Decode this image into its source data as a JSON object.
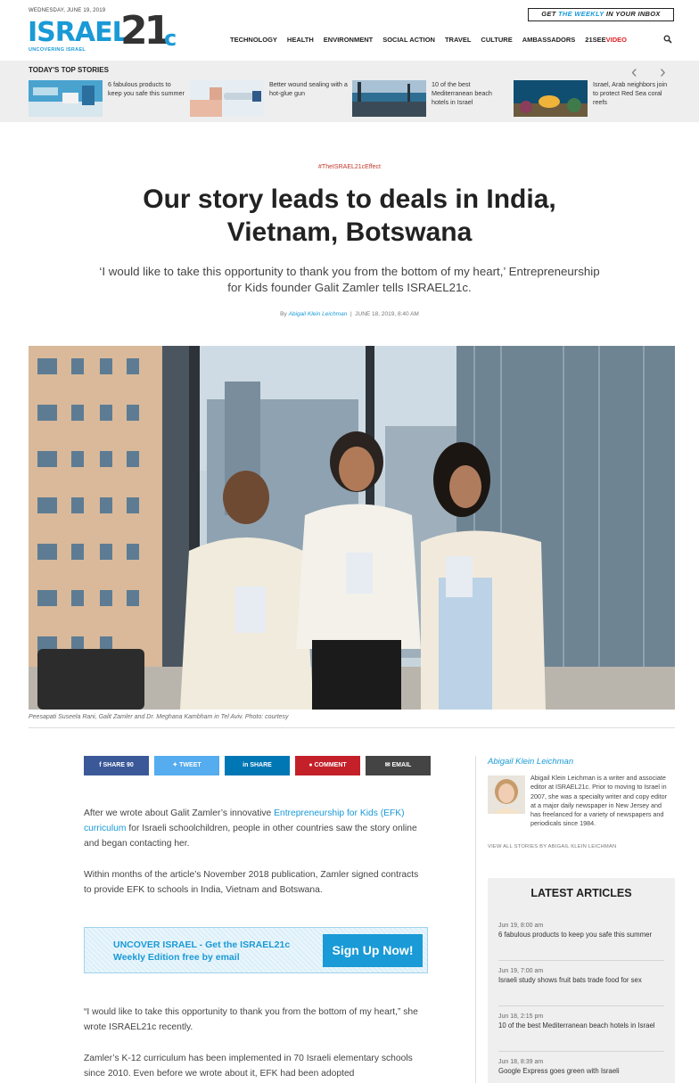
{
  "header": {
    "date": "WEDNESDAY, JUNE 19, 2019",
    "logo": {
      "israel": "ISRAEL",
      "number": "21",
      "suffix": "c",
      "tagline": "UNCOVERING ISRAEL"
    },
    "inbox": {
      "pre": "GET ",
      "highlight": "THE WEEKLY",
      "post": " IN YOUR INBOX"
    },
    "nav": [
      "TECHNOLOGY",
      "HEALTH",
      "ENVIRONMENT",
      "SOCIAL ACTION",
      "TRAVEL",
      "CULTURE",
      "AMBASSADORS"
    ],
    "nav_special": {
      "prefix": "21SEE",
      "suffix": "VIDEO"
    },
    "search_icon": "search-icon"
  },
  "top_stories": {
    "title": "TODAY'S TOP STORIES",
    "prev_icon": "chevron-left-icon",
    "next_icon": "chevron-right-icon",
    "items": [
      {
        "text": "6 fabulous products to keep you safe this summer"
      },
      {
        "text": "Better wound sealing with a hot-glue gun"
      },
      {
        "text": "10 of the best Mediterranean beach hotels in Israel"
      },
      {
        "text": "Israel, Arab neighbors join to protect Red Sea coral reefs"
      }
    ]
  },
  "article": {
    "kicker": "#TheISRAEL21cEffect",
    "headline": "Our story leads to deals in India, Vietnam, Botswana",
    "dek": "‘I would like to take this opportunity to thank you from the bottom of my heart,’ Entrepreneurship for Kids founder Galit Zamler tells ISRAEL21c.",
    "byline_prefix": "By ",
    "author": "Abigail Klein Leichman",
    "byline_sep": "|",
    "date": "JUNE 18, 2019, 8:40 AM",
    "caption": "Peesapati Suseela Rani, Galit Zamler and Dr. Meghana Kambham in Tel Aviv. Photo: courtesy"
  },
  "share": [
    {
      "label": "SHARE 90",
      "icon": "facebook-icon",
      "color": "#3b5998"
    },
    {
      "label": "TWEET",
      "icon": "twitter-icon",
      "color": "#55acee"
    },
    {
      "label": "SHARE",
      "icon": "linkedin-icon",
      "color": "#0077b5"
    },
    {
      "label": "COMMENT",
      "icon": "comment-icon",
      "color": "#c4202a"
    },
    {
      "label": "EMAIL",
      "icon": "email-icon",
      "color": "#444444"
    }
  ],
  "body": {
    "p1_a": "After we wrote about Galit Zamler’s innovative ",
    "p1_link": "Entrepreneurship for Kids (EFK) curriculum",
    "p1_b": " for Israeli schoolchildren, people in other countries saw the story online and began contacting her.",
    "p2": "Within months of the article’s November 2018 publication, Zamler signed contracts to provide EFK to schools in India, Vietnam and Botswana.",
    "p3": "“I would like to take this opportunity to thank you from the bottom of my heart,” she wrote ISRAEL21c recently.",
    "p4": "Zamler’s K-12 curriculum has been implemented in 70 Israeli elementary schools since 2010. Even before we wrote about it, EFK had been adopted"
  },
  "signup": {
    "text": "UNCOVER ISRAEL - Get the ISRAEL21c Weekly Edition free by email",
    "button": "Sign Up Now!"
  },
  "sidebar": {
    "author_name": "Abigail Klein Leichman",
    "author_bio": "Abigail Klein Leichman is a writer and associate editor at ISRAEL21c. Prior to moving to Israel in 2007, she was a specialty writer and copy editor at a major daily newspaper in New Jersey and has freelanced for a variety of newspapers and periodicals since 1984.",
    "view_all": "VIEW ALL STORIES BY ABIGAIL KLEIN LEICHMAN",
    "latest_title": "LATEST ARTICLES",
    "latest": [
      {
        "time": "Jun 19, 8:00 am",
        "title": "6 fabulous products to keep you safe this summer"
      },
      {
        "time": "Jun 19, 7:00 am",
        "title": "Israeli study shows fruit bats trade food for sex"
      },
      {
        "time": "Jun 18, 2:15 pm",
        "title": "10 of the best Mediterranean beach hotels in Israel"
      },
      {
        "time": "Jun 18, 8:39 am",
        "title": "Google Express goes green with Israeli"
      }
    ]
  }
}
